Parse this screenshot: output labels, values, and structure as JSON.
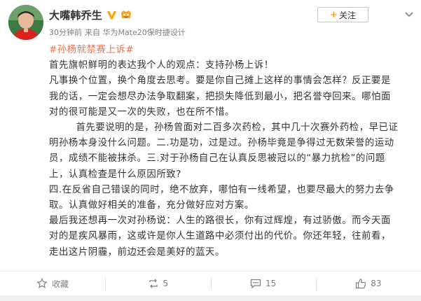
{
  "post": {
    "author": {
      "name": "大嘴韩乔生",
      "verified_icon": "verified-v-icon",
      "vip_icon": "vip-badge-icon"
    },
    "meta": {
      "time": "30分钟前",
      "source": "来自 华为Mate20保时捷设计"
    },
    "follow_button": {
      "plus": "+",
      "label": "关注"
    },
    "more_icon": "chevron-down-icon",
    "topic": "#孙杨就禁赛上诉#",
    "paragraphs": [
      "首先旗帜鲜明的表达我个人的观点：支持孙杨上诉！",
      "凡事换个位置，换个角度去思考。要是你自己摊上这样的事情会怎样？反正要是我的话，一定会想尽办法争取翻案，把损失降低到最小，把名誉夺回来。哪怕面对的很可能是又一次的失败，也在所不惜。",
      "        首先要说明的是，孙杨曾面对二百多次药检，其中几十次赛外药检，早已证明孙杨本身没什么问题。二.功是功，过是过。孙杨毕竟是争得过无数荣誉的运动员，成绩不能被抹杀。三.对于孙杨自己在认真反思被冠以的“暴力抗检”的问题上，认真检查是什么原因所致?",
      "四.在反省自己错误的同时，绝不放弃，哪怕有一线希望，也要尽最大的努力去争取。认真做好相关的准备，充分做好应对方案。",
      "最后我还想再一次对孙杨说：人生的路很长，你有过辉煌，有过骄傲。而今天面对的是疾风暴雨，这或许是你人生道路中必须付出的代价。你还年轻，往前看，走出这片阴霾，前边还会是美好的蓝天。"
    ]
  },
  "actions": {
    "favorite": {
      "icon": "favorite-icon",
      "label": "收藏"
    },
    "repost": {
      "icon": "repost-icon",
      "label": "5"
    },
    "comment": {
      "icon": "comment-icon",
      "label": "15"
    },
    "like": {
      "icon": "thumbs-up-icon",
      "label": "83"
    }
  },
  "colors": {
    "topic": "#eb7350",
    "follow_plus": "#ff8200",
    "meta_text": "#808080",
    "vip_badge": "#f5a623",
    "verified": "#ffa00a"
  }
}
